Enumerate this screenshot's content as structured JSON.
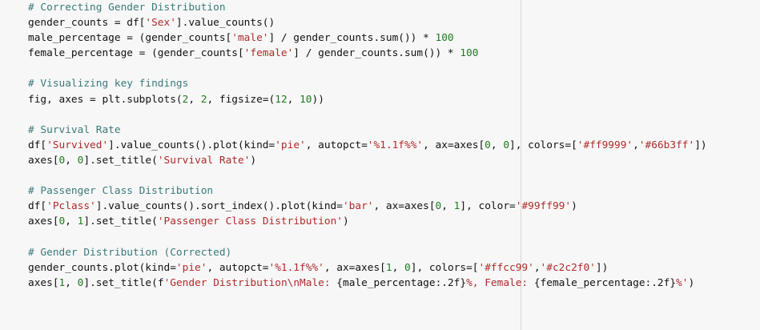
{
  "code_lines": [
    {
      "segs": [
        {
          "t": "# Correcting Gender Distribution",
          "c": "comment"
        }
      ]
    },
    {
      "segs": [
        {
          "t": "gender_counts = df[",
          "c": ""
        },
        {
          "t": "'Sex'",
          "c": "str"
        },
        {
          "t": "].value_counts()",
          "c": ""
        }
      ]
    },
    {
      "segs": [
        {
          "t": "male_percentage = (gender_counts[",
          "c": ""
        },
        {
          "t": "'male'",
          "c": "str"
        },
        {
          "t": "] / gender_counts.sum()) * ",
          "c": ""
        },
        {
          "t": "100",
          "c": "num"
        }
      ]
    },
    {
      "segs": [
        {
          "t": "female_percentage = (gender_counts[",
          "c": ""
        },
        {
          "t": "'female'",
          "c": "str"
        },
        {
          "t": "] / gender_counts.sum()) * ",
          "c": ""
        },
        {
          "t": "100",
          "c": "num"
        }
      ]
    },
    {
      "segs": []
    },
    {
      "segs": [
        {
          "t": "# Visualizing key findings",
          "c": "comment"
        }
      ]
    },
    {
      "segs": [
        {
          "t": "fig, axes = plt.subplots(",
          "c": ""
        },
        {
          "t": "2",
          "c": "num"
        },
        {
          "t": ", ",
          "c": ""
        },
        {
          "t": "2",
          "c": "num"
        },
        {
          "t": ", figsize=(",
          "c": ""
        },
        {
          "t": "12",
          "c": "num"
        },
        {
          "t": ", ",
          "c": ""
        },
        {
          "t": "10",
          "c": "num"
        },
        {
          "t": "))",
          "c": ""
        }
      ]
    },
    {
      "segs": []
    },
    {
      "segs": [
        {
          "t": "# Survival Rate",
          "c": "comment"
        }
      ]
    },
    {
      "segs": [
        {
          "t": "df[",
          "c": ""
        },
        {
          "t": "'Survived'",
          "c": "str"
        },
        {
          "t": "].value_counts().plot(kind=",
          "c": ""
        },
        {
          "t": "'pie'",
          "c": "str"
        },
        {
          "t": ", autopct=",
          "c": ""
        },
        {
          "t": "'%1.1f%%'",
          "c": "str"
        },
        {
          "t": ", ax=axes[",
          "c": ""
        },
        {
          "t": "0",
          "c": "num"
        },
        {
          "t": ", ",
          "c": ""
        },
        {
          "t": "0",
          "c": "num"
        },
        {
          "t": "], colors=[",
          "c": ""
        },
        {
          "t": "'#ff9999'",
          "c": "str"
        },
        {
          "t": ",",
          "c": ""
        },
        {
          "t": "'#66b3ff'",
          "c": "str"
        },
        {
          "t": "])",
          "c": ""
        }
      ]
    },
    {
      "segs": [
        {
          "t": "axes[",
          "c": ""
        },
        {
          "t": "0",
          "c": "num"
        },
        {
          "t": ", ",
          "c": ""
        },
        {
          "t": "0",
          "c": "num"
        },
        {
          "t": "].set_title(",
          "c": ""
        },
        {
          "t": "'Survival Rate'",
          "c": "str"
        },
        {
          "t": ")",
          "c": ""
        }
      ]
    },
    {
      "segs": []
    },
    {
      "segs": [
        {
          "t": "# Passenger Class Distribution",
          "c": "comment"
        }
      ]
    },
    {
      "segs": [
        {
          "t": "df[",
          "c": ""
        },
        {
          "t": "'Pclass'",
          "c": "str"
        },
        {
          "t": "].value_counts().sort_index().plot(kind=",
          "c": ""
        },
        {
          "t": "'bar'",
          "c": "str"
        },
        {
          "t": ", ax=axes[",
          "c": ""
        },
        {
          "t": "0",
          "c": "num"
        },
        {
          "t": ", ",
          "c": ""
        },
        {
          "t": "1",
          "c": "num"
        },
        {
          "t": "], color=",
          "c": ""
        },
        {
          "t": "'#99ff99'",
          "c": "str"
        },
        {
          "t": ")",
          "c": ""
        }
      ]
    },
    {
      "segs": [
        {
          "t": "axes[",
          "c": ""
        },
        {
          "t": "0",
          "c": "num"
        },
        {
          "t": ", ",
          "c": ""
        },
        {
          "t": "1",
          "c": "num"
        },
        {
          "t": "].set_title(",
          "c": ""
        },
        {
          "t": "'Passenger Class Distribution'",
          "c": "str"
        },
        {
          "t": ")",
          "c": ""
        }
      ]
    },
    {
      "segs": []
    },
    {
      "segs": [
        {
          "t": "# Gender Distribution (Corrected)",
          "c": "comment"
        }
      ]
    },
    {
      "segs": [
        {
          "t": "gender_counts.plot(kind=",
          "c": ""
        },
        {
          "t": "'pie'",
          "c": "str"
        },
        {
          "t": ", autopct=",
          "c": ""
        },
        {
          "t": "'%1.1f%%'",
          "c": "str"
        },
        {
          "t": ", ax=axes[",
          "c": ""
        },
        {
          "t": "1",
          "c": "num"
        },
        {
          "t": ", ",
          "c": ""
        },
        {
          "t": "0",
          "c": "num"
        },
        {
          "t": "], colors=[",
          "c": ""
        },
        {
          "t": "'#ffcc99'",
          "c": "str"
        },
        {
          "t": ",",
          "c": ""
        },
        {
          "t": "'#c2c2f0'",
          "c": "str"
        },
        {
          "t": "])",
          "c": ""
        }
      ]
    },
    {
      "segs": [
        {
          "t": "axes[",
          "c": ""
        },
        {
          "t": "1",
          "c": "num"
        },
        {
          "t": ", ",
          "c": ""
        },
        {
          "t": "0",
          "c": "num"
        },
        {
          "t": "].set_title(f",
          "c": ""
        },
        {
          "t": "'Gender Distribution\\nMale: ",
          "c": "str"
        },
        {
          "t": "{male_percentage:.2f}",
          "c": ""
        },
        {
          "t": "%, Female: ",
          "c": "str"
        },
        {
          "t": "{female_percentage:.2f}",
          "c": ""
        },
        {
          "t": "%'",
          "c": "str"
        },
        {
          "t": ")",
          "c": ""
        }
      ]
    }
  ],
  "colors": {
    "background": "#f7f7f7",
    "comment": "#3a7a7a",
    "string": "#b02a2a",
    "number": "#1f7a1f",
    "ruler": "#d8d8d8"
  }
}
